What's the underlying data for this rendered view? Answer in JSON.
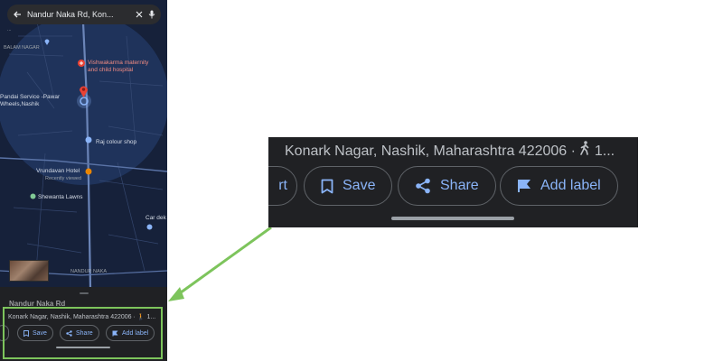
{
  "search": {
    "query": "Nandur Naka Rd, Kon...",
    "back_icon": "arrow-back-icon",
    "clear_icon": "close-icon",
    "mic_icon": "mic-icon"
  },
  "map_labels": {
    "top_small": "...",
    "balam_nagar": "BALAM NAGAR",
    "hospital_line1": "Vishwakarma maternity",
    "hospital_line2": "and child hospital",
    "service_line1": "Pandai Service -Pawar",
    "service_line2": "Wheels,Nashik",
    "raj_colour": "Raj colour shop",
    "vrundavan": "Vrundavan Hotel",
    "recently_viewed": "Recently viewed",
    "shewanta": "Shewanta Lawns",
    "car_dek": "Car dek",
    "nandur_naka": "NANDUR NAKA",
    "sheet_title": "Nandur Naka Rd"
  },
  "place": {
    "address": "Konark Nagar, Nashik, Maharashtra 422006 ·",
    "travel_time": "1...",
    "walk_icon": "walking-person-icon"
  },
  "actions": {
    "partial_label": "rt",
    "save_label": "Save",
    "share_label": "Share",
    "add_label_label": "Add label"
  },
  "colors": {
    "accent_blue": "#8ab4f8",
    "sheet_bg": "#202124",
    "highlight_green": "#7dc45c",
    "pin_red": "#ea4335"
  }
}
